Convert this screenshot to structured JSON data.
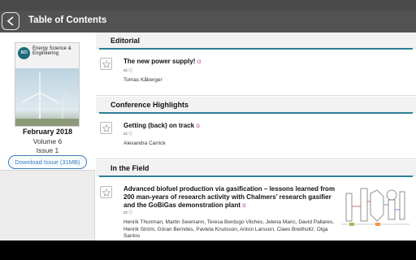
{
  "header": {
    "title": "Table of Contents",
    "back_icon": "chevron-left-icon"
  },
  "issue": {
    "cover": {
      "journal_name": "Energy Science & Engineering",
      "logo_text": "SCI"
    },
    "date": "February 2018",
    "volume": "Volume 6",
    "issue": "Issue 1",
    "download_label": "Download Issue (31MB)"
  },
  "sections": [
    {
      "title": "Editorial",
      "articles": [
        {
          "title": "The new power supply!",
          "authors": "Tomas Kåberger",
          "license": "cc ⓘ",
          "open_access": "ɑ"
        }
      ]
    },
    {
      "title": "Conference Highlights",
      "articles": [
        {
          "title": "Getting (back) on track",
          "authors": "Alexandra Carrick",
          "license": "cc ⓘ",
          "open_access": "ɑ"
        }
      ]
    },
    {
      "title": "In the Field",
      "articles": [
        {
          "title": "Advanced biofuel production via gasification – lessons learned from 200 man-years of research activity with Chalmers’ research gasifier and the GoBiGas demonstration plant",
          "authors": "Henrik Thunman, Martin Seemann, Teresa Berdugo Vilches, Jelena Maric, David Pallares, Henrik Ström, Göran Berndes, Pavleta Knutsson, Anton Larsson, Claes Breitholtz, Olga Santos",
          "license": "cc ⓘ",
          "open_access": "ɑ"
        }
      ]
    }
  ],
  "colors": {
    "accent_rule": "#2e7f94",
    "download_button": "#3f7fbf",
    "open_access": "#b0559f",
    "title_bar": "#525252"
  }
}
